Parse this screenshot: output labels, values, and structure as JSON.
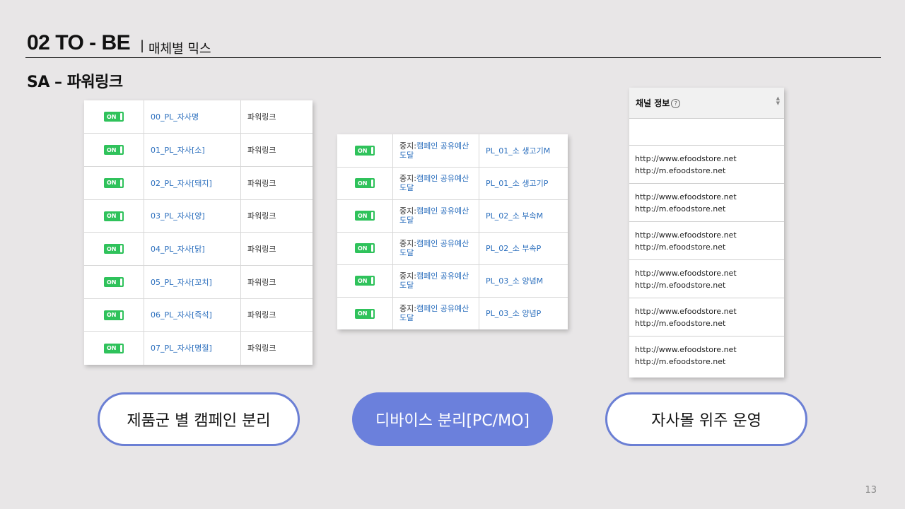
{
  "header": {
    "title": "02 TO - BE",
    "separator": "|",
    "subtitle": "매체별 믹스"
  },
  "section_title": "SA – 파워링크",
  "campaigns": {
    "toggle_label": "ON",
    "rows": [
      {
        "name": "00_PL_자사명",
        "type": "파워링크"
      },
      {
        "name": "01_PL_자사[소]",
        "type": "파워링크"
      },
      {
        "name": "02_PL_자사[돼지]",
        "type": "파워링크"
      },
      {
        "name": "03_PL_자사[양]",
        "type": "파워링크"
      },
      {
        "name": "04_PL_자사[닭]",
        "type": "파워링크"
      },
      {
        "name": "05_PL_자사[꼬치]",
        "type": "파워링크"
      },
      {
        "name": "06_PL_자사[즉석]",
        "type": "파워링크"
      },
      {
        "name": "07_PL_자사[명절]",
        "type": "파워링크"
      }
    ]
  },
  "adgroups": {
    "toggle_label": "ON",
    "status_prefix": "중지:",
    "status_link_line1": "캠페인 공유예산",
    "status_link_line2": "도달",
    "rows": [
      {
        "name": "PL_01_소 생고기M"
      },
      {
        "name": "PL_01_소 생고기P"
      },
      {
        "name": "PL_02_소 부속M"
      },
      {
        "name": "PL_02_소 부속P"
      },
      {
        "name": "PL_03_소 양념M"
      },
      {
        "name": "PL_03_소 양념P"
      }
    ]
  },
  "channel": {
    "header": "채널 정보",
    "help_icon_label": "?",
    "rows": [
      {
        "pc": "http://www.efoodstore.net",
        "mobile": "http://m.efoodstore.net"
      },
      {
        "pc": "http://www.efoodstore.net",
        "mobile": "http://m.efoodstore.net"
      },
      {
        "pc": "http://www.efoodstore.net",
        "mobile": "http://m.efoodstore.net"
      },
      {
        "pc": "http://www.efoodstore.net",
        "mobile": "http://m.efoodstore.net"
      },
      {
        "pc": "http://www.efoodstore.net",
        "mobile": "http://m.efoodstore.net"
      },
      {
        "pc": "http://www.efoodstore.net",
        "mobile": "http://m.efoodstore.net"
      }
    ]
  },
  "pills": {
    "left": "제품군 별 캠페인 분리",
    "center": "디바이스 분리[PC/MO]",
    "right": "자사몰 위주 운영"
  },
  "page_number": "13",
  "colors": {
    "accent": "#6b80dc",
    "toggle": "#2fc25b",
    "link": "#2a6ebd"
  }
}
